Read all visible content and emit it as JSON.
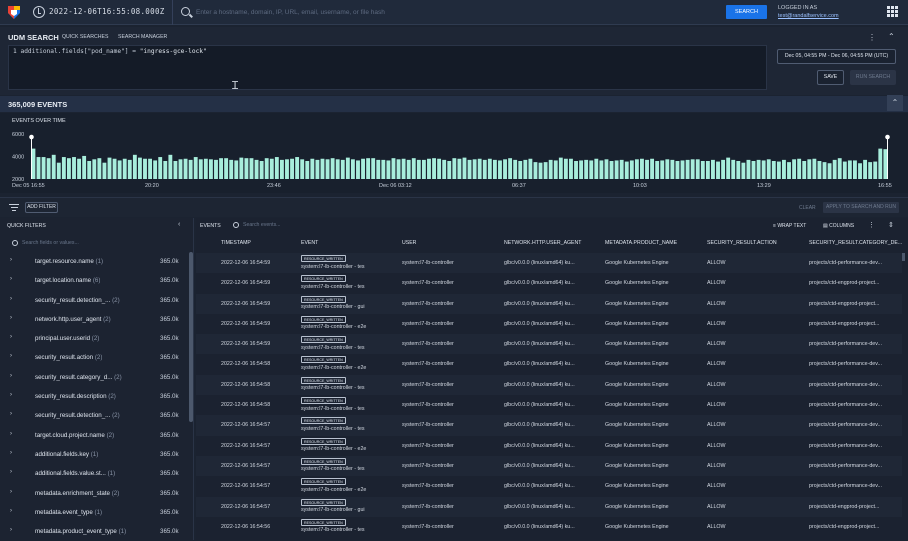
{
  "topbar": {
    "datetime": "2022-12-06T16:55:08.000Z",
    "search_placeholder": "Enter a hostname, domain, IP, URL, email, username, or file hash",
    "search_button": "SEARCH",
    "logged_in_label": "LOGGED IN AS",
    "user_email": "test@randalfservice.com"
  },
  "udm": {
    "title": "UDM SEARCH",
    "tabs": [
      "QUICK SEARCHES",
      "SEARCH MANAGER"
    ],
    "line_number": "1",
    "query_field": "additional.fields[\"pod_name\"]",
    "query_op": " = ",
    "query_value": "\"ingress-gce-lock\"",
    "date_range": "Dec 05, 04:55 PM - Dec 06, 04:55 PM (UTC)",
    "save_button": "SAVE",
    "run_button": "RUN SEARCH"
  },
  "events_header": {
    "count_label": "365,009 EVENTS"
  },
  "chart_data": {
    "type": "bar",
    "title": "EVENTS OVER TIME",
    "y_ticks": [
      "6000",
      "4000",
      "2000"
    ],
    "ylim": [
      2000,
      6000
    ],
    "x_ticks": [
      "Dec 05 16:55",
      "20:20",
      "23:46",
      "Dec 06 03:12",
      "06:37",
      "10:03",
      "13:29",
      "16:55"
    ],
    "values": [
      4700,
      3950,
      3950,
      3850,
      4150,
      3450,
      3950,
      3850,
      3950,
      3800,
      4050,
      3600,
      3750,
      3850,
      3450,
      3900,
      3800,
      3650,
      3800,
      3700,
      4150,
      3900,
      3800,
      3800,
      3650,
      3950,
      3600,
      4150,
      3600,
      3750,
      3800,
      3700,
      3950,
      3750,
      3800,
      3750,
      3700,
      3850,
      3850,
      3700,
      3650,
      3900,
      3850,
      3850,
      3700,
      3600,
      3850,
      3800,
      3950,
      3700,
      3750,
      3800,
      3950,
      3750,
      3600,
      3800,
      3700,
      3800,
      3750,
      3850,
      3750,
      3700,
      3900,
      3750,
      3650,
      3800,
      3850,
      3850,
      3700,
      3700,
      3650,
      3850,
      3750,
      3800,
      3700,
      3850,
      3700,
      3700,
      3800,
      3850,
      3800,
      3700,
      3600,
      3850,
      3800,
      3900,
      3700,
      3750,
      3800,
      3700,
      3800,
      3700,
      3650,
      3750,
      3850,
      3700,
      3600,
      3700,
      3800,
      3500,
      3450,
      3500,
      3700,
      3650,
      3900,
      3800,
      3800,
      3600,
      3650,
      3700,
      3650,
      3800,
      3650,
      3750,
      3600,
      3650,
      3700,
      3550,
      3650,
      3750,
      3800,
      3700,
      3800,
      3600,
      3650,
      3750,
      3700,
      3600,
      3650,
      3700,
      3750,
      3750,
      3600,
      3600,
      3700,
      3550,
      3700,
      3900,
      3700,
      3600,
      3450,
      3700,
      3600,
      3700,
      3650,
      3750,
      3600,
      3550,
      3700,
      3500,
      3750,
      3800,
      3600,
      3750,
      3800,
      3600,
      3500,
      3400,
      3700,
      3850,
      3550,
      3650,
      3650,
      3400,
      3700,
      3500,
      3550,
      4700,
      4650
    ]
  },
  "filters": {
    "add_filter": "ADD FILTER",
    "clear": "CLEAR",
    "apply": "APPLY TO SEARCH AND RUN"
  },
  "quick_filters": {
    "title": "QUICK FILTERS",
    "search_placeholder": "Search fields or values...",
    "items": [
      {
        "name": "target.resource.name",
        "count": "(1)",
        "value": "365.0k"
      },
      {
        "name": "target.location.name",
        "count": "(6)",
        "value": "365.0k"
      },
      {
        "name": "security_result.detection_...",
        "count": "(2)",
        "value": "365.0k"
      },
      {
        "name": "network.http.user_agent",
        "count": "(2)",
        "value": "365.0k"
      },
      {
        "name": "principal.user.userid",
        "count": "(2)",
        "value": "365.0k"
      },
      {
        "name": "security_result.action",
        "count": "(2)",
        "value": "365.0k"
      },
      {
        "name": "security_result.category_d...",
        "count": "(2)",
        "value": "365.0k"
      },
      {
        "name": "security_result.description",
        "count": "(2)",
        "value": "365.0k"
      },
      {
        "name": "security_result.detection_...",
        "count": "(2)",
        "value": "365.0k"
      },
      {
        "name": "target.cloud.project.name",
        "count": "(2)",
        "value": "365.0k"
      },
      {
        "name": "additional.fields.key",
        "count": "(1)",
        "value": "365.0k"
      },
      {
        "name": "additional.fields.value.st...",
        "count": "(1)",
        "value": "365.0k"
      },
      {
        "name": "metadata.enrichment_state",
        "count": "(2)",
        "value": "365.0k"
      },
      {
        "name": "metadata.event_type",
        "count": "(1)",
        "value": "365.0k"
      },
      {
        "name": "metadata.product_event_type",
        "count": "(1)",
        "value": "365.0k"
      }
    ]
  },
  "events_table": {
    "tab_label": "EVENTS",
    "search_placeholder": "Search events...",
    "wrap_text": "WRAP TEXT",
    "columns_label": "COLUMNS",
    "headers": [
      "TIMESTAMP",
      "EVENT",
      "USER",
      "NETWORK.HTTP.USER_AGENT",
      "METADATA.PRODUCT_NAME",
      "SECURITY_RESULT.ACTION",
      "SECURITY_RESULT.CATEGORY_DE..."
    ],
    "rows": [
      {
        "ts": "2022-12-06 16:54:59",
        "badge": "RESOURCE_WRITTEN",
        "event": "system:l7-lb-controller - tes",
        "user": "system:l7-lb-controller",
        "agent": "glbc/v0.0.0 (linux/amd64) ku...",
        "product": "Google Kubernetes Engine",
        "action": "ALLOW",
        "category": "projects/ctd-performance-dev..."
      },
      {
        "ts": "2022-12-06 16:54:59",
        "badge": "RESOURCE_WRITTEN",
        "event": "system:l7-lb-controller - tes",
        "user": "system:l7-lb-controller",
        "agent": "glbc/v0.0.0 (linux/amd64) ku...",
        "product": "Google Kubernetes Engine",
        "action": "ALLOW",
        "category": "projects/ctd-engprod-project..."
      },
      {
        "ts": "2022-12-06 16:54:59",
        "badge": "RESOURCE_WRITTEN",
        "event": "system:l7-lb-controller - gui",
        "user": "system:l7-lb-controller",
        "agent": "glbc/v0.0.0 (linux/amd64) ku...",
        "product": "Google Kubernetes Engine",
        "action": "ALLOW",
        "category": "projects/ctd-engprod-project..."
      },
      {
        "ts": "2022-12-06 16:54:59",
        "badge": "RESOURCE_WRITTEN",
        "event": "system:l7-lb-controller - e2e",
        "user": "system:l7-lb-controller",
        "agent": "glbc/v0.0.0 (linux/amd64) ku...",
        "product": "Google Kubernetes Engine",
        "action": "ALLOW",
        "category": "projects/ctd-engprod-project..."
      },
      {
        "ts": "2022-12-06 16:54:59",
        "badge": "RESOURCE_WRITTEN",
        "event": "system:l7-lb-controller - tes",
        "user": "system:l7-lb-controller",
        "agent": "glbc/v0.0.0 (linux/amd64) ku...",
        "product": "Google Kubernetes Engine",
        "action": "ALLOW",
        "category": "projects/ctd-performance-dev..."
      },
      {
        "ts": "2022-12-06 16:54:58",
        "badge": "RESOURCE_WRITTEN",
        "event": "system:l7-lb-controller - e2e",
        "user": "system:l7-lb-controller",
        "agent": "glbc/v0.0.0 (linux/amd64) ku...",
        "product": "Google Kubernetes Engine",
        "action": "ALLOW",
        "category": "projects/ctd-performance-dev..."
      },
      {
        "ts": "2022-12-06 16:54:58",
        "badge": "RESOURCE_WRITTEN",
        "event": "system:l7-lb-controller - tes",
        "user": "system:l7-lb-controller",
        "agent": "glbc/v0.0.0 (linux/amd64) ku...",
        "product": "Google Kubernetes Engine",
        "action": "ALLOW",
        "category": "projects/ctd-performance-dev..."
      },
      {
        "ts": "2022-12-06 16:54:58",
        "badge": "RESOURCE_WRITTEN",
        "event": "system:l7-lb-controller - tes",
        "user": "system:l7-lb-controller",
        "agent": "glbc/v0.0.0 (linux/amd64) ku...",
        "product": "Google Kubernetes Engine",
        "action": "ALLOW",
        "category": "projects/ctd-performance-dev..."
      },
      {
        "ts": "2022-12-06 16:54:57",
        "badge": "RESOURCE_WRITTEN",
        "event": "system:l7-lb-controller - tes",
        "user": "system:l7-lb-controller",
        "agent": "glbc/v0.0.0 (linux/amd64) ku...",
        "product": "Google Kubernetes Engine",
        "action": "ALLOW",
        "category": "projects/ctd-performance-dev..."
      },
      {
        "ts": "2022-12-06 16:54:57",
        "badge": "RESOURCE_WRITTEN",
        "event": "system:l7-lb-controller - e2e",
        "user": "system:l7-lb-controller",
        "agent": "glbc/v0.0.0 (linux/amd64) ku...",
        "product": "Google Kubernetes Engine",
        "action": "ALLOW",
        "category": "projects/ctd-performance-dev..."
      },
      {
        "ts": "2022-12-06 16:54:57",
        "badge": "RESOURCE_WRITTEN",
        "event": "system:l7-lb-controller - tes",
        "user": "system:l7-lb-controller",
        "agent": "glbc/v0.0.0 (linux/amd64) ku...",
        "product": "Google Kubernetes Engine",
        "action": "ALLOW",
        "category": "projects/ctd-performance-dev..."
      },
      {
        "ts": "2022-12-06 16:54:57",
        "badge": "RESOURCE_WRITTEN",
        "event": "system:l7-lb-controller - e2e",
        "user": "system:l7-lb-controller",
        "agent": "glbc/v0.0.0 (linux/amd64) ku...",
        "product": "Google Kubernetes Engine",
        "action": "ALLOW",
        "category": "projects/ctd-performance-dev..."
      },
      {
        "ts": "2022-12-06 16:54:57",
        "badge": "RESOURCE_WRITTEN",
        "event": "system:l7-lb-controller - gui",
        "user": "system:l7-lb-controller",
        "agent": "glbc/v0.0.0 (linux/amd64) ku...",
        "product": "Google Kubernetes Engine",
        "action": "ALLOW",
        "category": "projects/ctd-engprod-project..."
      },
      {
        "ts": "2022-12-06 16:54:56",
        "badge": "RESOURCE_WRITTEN",
        "event": "system:l7-lb-controller - tes",
        "user": "system:l7-lb-controller",
        "agent": "glbc/v0.0.0 (linux/amd64) ku...",
        "product": "Google Kubernetes Engine",
        "action": "ALLOW",
        "category": "projects/ctd-engprod-project..."
      }
    ]
  },
  "colors": {
    "accent": "#1a73e8",
    "bar": "#a8eedc",
    "panel": "#1b2331"
  },
  "icons": [
    "logo-icon",
    "clock-icon",
    "search-icon",
    "apps-grid-icon",
    "filter-icon",
    "chevron-right-icon",
    "more-vert-icon",
    "text-cursor-icon"
  ]
}
